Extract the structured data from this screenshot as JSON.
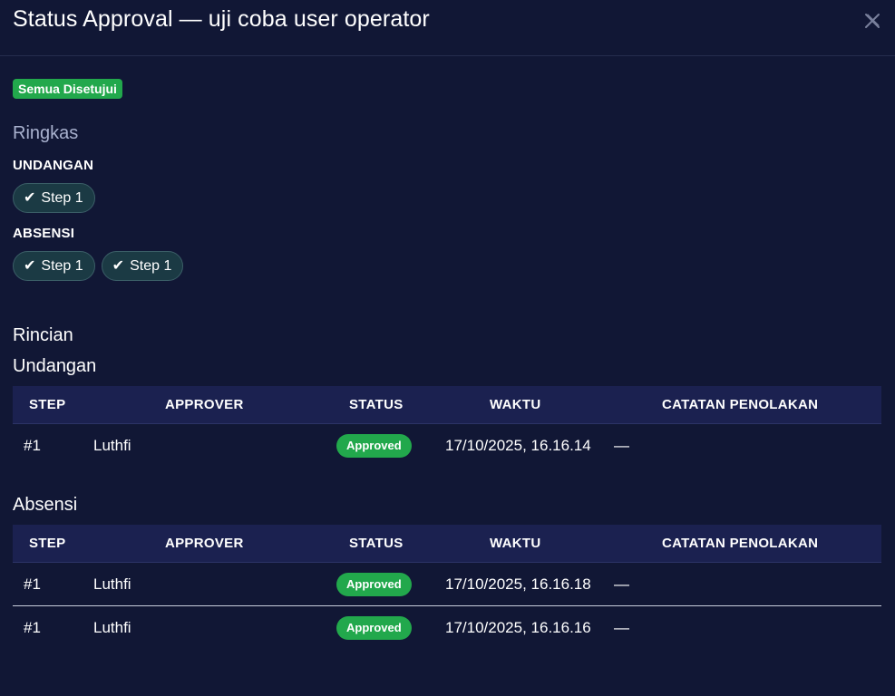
{
  "dialog": {
    "title": "Status Approval — uji coba user operator",
    "close_icon": "close-icon"
  },
  "overall_status": {
    "label": "Semua Disetujui",
    "color": "#22a84c"
  },
  "summary": {
    "title": "Ringkas",
    "groups": [
      {
        "label": "UNDANGAN",
        "steps": [
          "Step 1"
        ]
      },
      {
        "label": "ABSENSI",
        "steps": [
          "Step 1",
          "Step 1"
        ]
      }
    ],
    "check_glyph": "✔"
  },
  "details": {
    "title": "Rincian",
    "columns": [
      "STEP",
      "APPROVER",
      "STATUS",
      "WAKTU",
      "CATATAN PENOLAKAN"
    ],
    "sections": [
      {
        "title": "Undangan",
        "rows": [
          {
            "step": "#1",
            "approver": "Luthfi",
            "status": "Approved",
            "time": "17/10/2025, 16.16.14",
            "note": "—"
          }
        ]
      },
      {
        "title": "Absensi",
        "rows": [
          {
            "step": "#1",
            "approver": "Luthfi",
            "status": "Approved",
            "time": "17/10/2025, 16.16.18",
            "note": "—"
          },
          {
            "step": "#1",
            "approver": "Luthfi",
            "status": "Approved",
            "time": "17/10/2025, 16.16.16",
            "note": "—"
          }
        ]
      }
    ]
  },
  "colors": {
    "background": "#111735",
    "header_row": "#1b2150",
    "approved": "#22a84c",
    "chip_bg": "#1b3a44",
    "muted_text": "#a9b2cf"
  }
}
